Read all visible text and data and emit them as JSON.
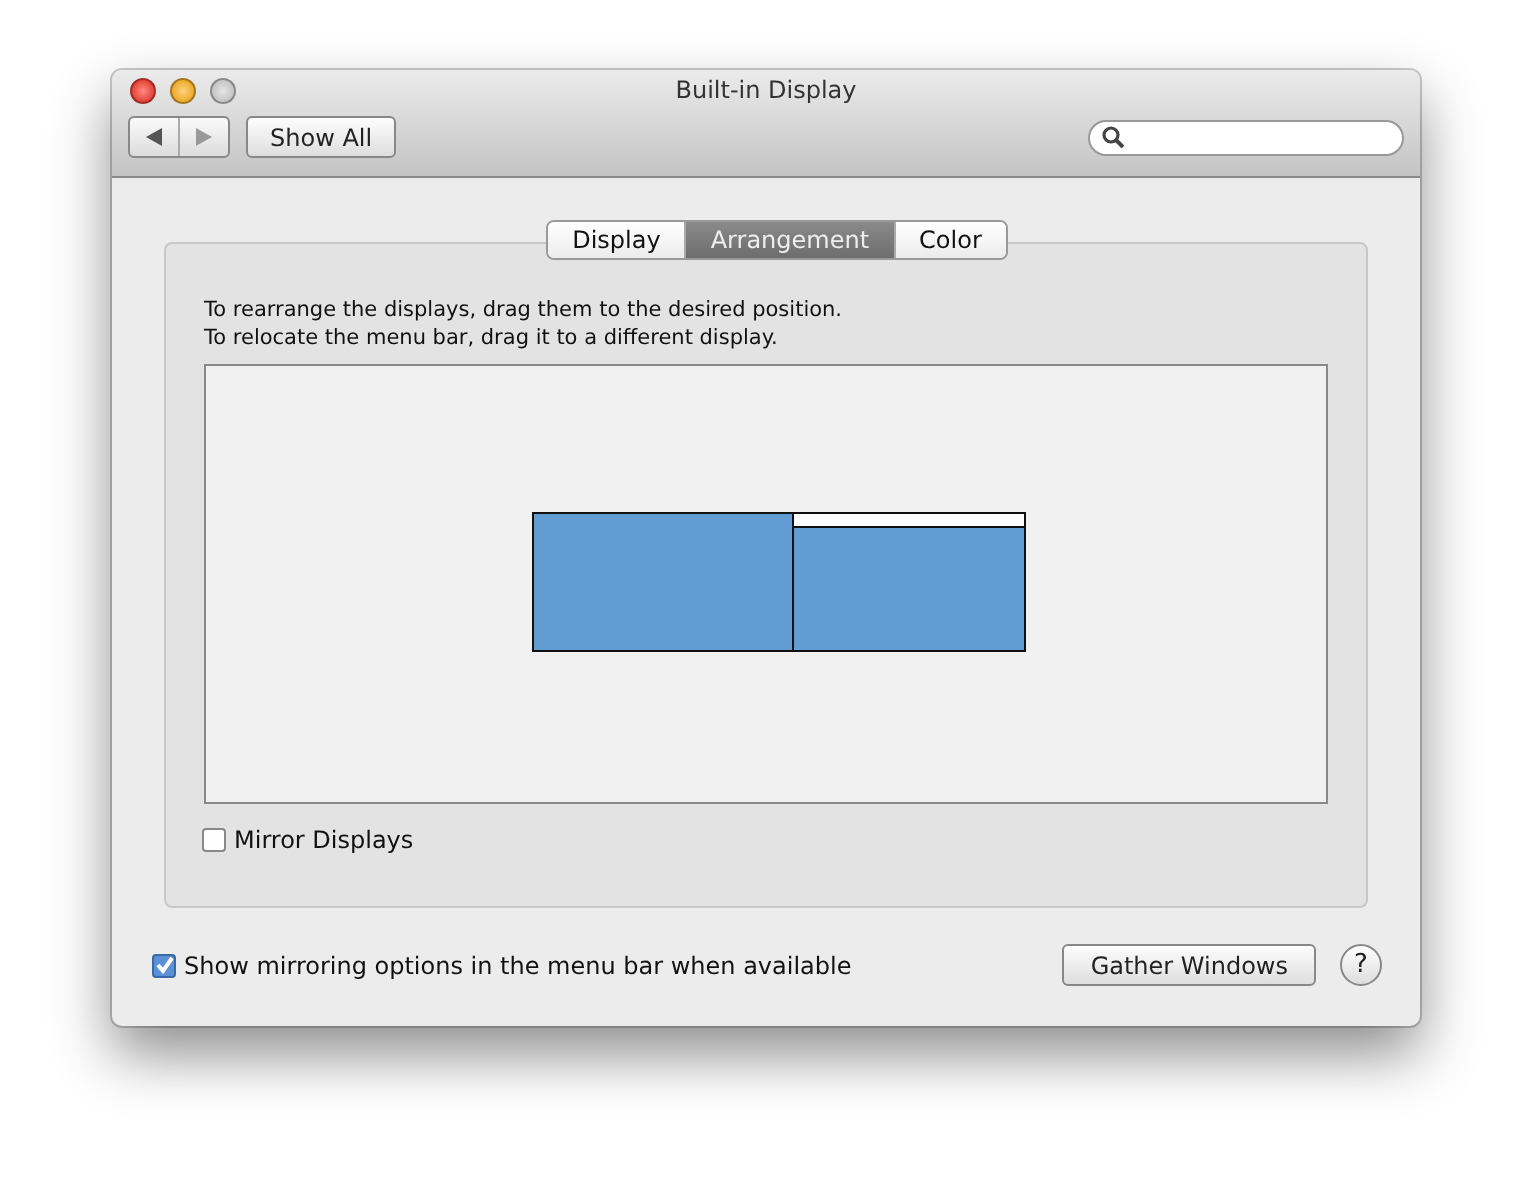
{
  "window": {
    "title": "Built-in Display"
  },
  "toolbar": {
    "show_all": "Show All"
  },
  "tabs": [
    {
      "label": "Display",
      "selected": false
    },
    {
      "label": "Arrangement",
      "selected": true
    },
    {
      "label": "Color",
      "selected": false
    }
  ],
  "instructions": [
    "To rearrange the displays, drag them to the desired position.",
    "To relocate the menu bar, drag it to a different display."
  ],
  "displays": [
    {
      "has_menu_bar": false
    },
    {
      "has_menu_bar": true
    }
  ],
  "mirror_displays": {
    "label": "Mirror Displays",
    "checked": false
  },
  "show_mirroring": {
    "label": "Show mirroring options in the menu bar when available",
    "checked": true
  },
  "buttons": {
    "gather": "Gather Windows",
    "help": "?"
  }
}
